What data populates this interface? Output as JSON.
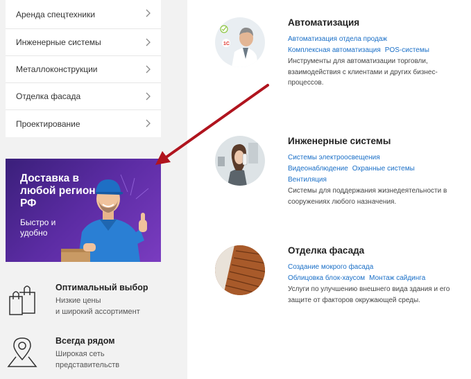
{
  "sidebar": {
    "menu": [
      {
        "label": "Аренда спецтехники"
      },
      {
        "label": "Инженерные системы"
      },
      {
        "label": "Металлоконструкции"
      },
      {
        "label": "Отделка фасада"
      },
      {
        "label": "Проектирование"
      }
    ],
    "banner": {
      "title": "Доставка в любой регион РФ",
      "subtitle": "Быстро и удобно",
      "colors": {
        "bg_from": "#3a1f7a",
        "bg_to": "#7a3cc0"
      }
    },
    "features": [
      {
        "icon": "shopping-bag-icon",
        "title": "Оптимальный выбор",
        "line1": "Низкие цены",
        "line2": "и широкий ассортимент"
      },
      {
        "icon": "map-pin-icon",
        "title": "Всегда рядом",
        "line1": "Широкая сеть",
        "line2": "представительств"
      }
    ]
  },
  "services": [
    {
      "title": "Автоматизация",
      "link_rows": [
        [
          "Автоматизация отдела продаж"
        ],
        [
          "Комплексная автоматизация",
          "POS-системы"
        ]
      ],
      "description": "Инструменты для автоматизации торговли, взаимодействия с клиентами и других бизнес-процессов."
    },
    {
      "title": "Инженерные системы",
      "link_rows": [
        [
          "Системы электроосвещения"
        ],
        [
          "Видеонаблюдение",
          "Охранные системы"
        ],
        [
          "Вентиляция"
        ]
      ],
      "description": "Системы для поддержания жизнедеятельности в сооружениях любого назначения."
    },
    {
      "title": "Отделка фасада",
      "link_rows": [
        [
          "Создание мокрого фасада"
        ],
        [
          "Облицовка блок-хаусом",
          "Монтаж сайдинга"
        ]
      ],
      "description": "Услуги по улучшению внешнего вида здания и его защите от факторов окружающей среды."
    }
  ],
  "colors": {
    "link": "#1a6fc7",
    "arrow": "#b0141e",
    "sidebar_bg": "#f2f2f2"
  }
}
